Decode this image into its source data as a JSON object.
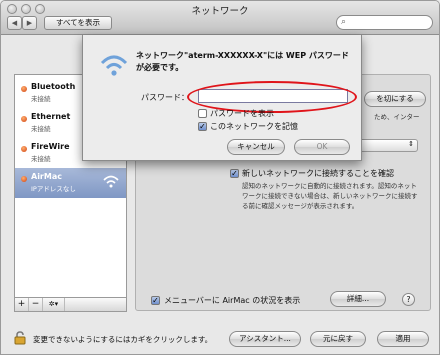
{
  "window": {
    "title": "ネットワーク",
    "show_all": "すべてを表示",
    "search_placeholder": "",
    "search_icon": "magnifier-icon",
    "back_icon": "◀",
    "forward_icon": "▶"
  },
  "sidebar": {
    "items": [
      {
        "name": "Bluetooth",
        "status": "未接続"
      },
      {
        "name": "Ethernet",
        "status": "未接続"
      },
      {
        "name": "FireWire",
        "status": "未接続"
      },
      {
        "name": "AirMac",
        "status": "IPアドレスなし"
      }
    ],
    "add": "+",
    "remove": "−",
    "gear": "✲▾"
  },
  "panel": {
    "turn_off_button": "を切にする",
    "behind_text": "ため、インター",
    "ask_new_network_label": "新しいネットワークに接続することを確認",
    "ask_new_network_desc": "認知のネットワークに自動的に接続されます。認知のネットワークに接続できない場合は、新しいネットワークに接続する前に確認メッセージが表示されます。",
    "show_status_label": "メニューバーに AirMac の状況を表示",
    "advanced_button": "詳細..."
  },
  "footer": {
    "lock_text": "変更できないようにするにはカギをクリックします。",
    "assistant_button": "アシスタント...",
    "revert_button": "元に戻す",
    "apply_button": "適用"
  },
  "dialog": {
    "message": "ネットワーク\"aterm-XXXXXX-X\"には WEP パスワードが必要です。",
    "password_label": "パスワード：",
    "password_value": "",
    "show_password_label": "パスワードを表示",
    "remember_label": "このネットワークを記憶",
    "cancel_button": "キャンセル",
    "ok_button": "OK",
    "show_password_checked": false,
    "remember_checked": true
  },
  "colors": {
    "highlight": "#e0141a",
    "selection": "#7f97c4"
  }
}
